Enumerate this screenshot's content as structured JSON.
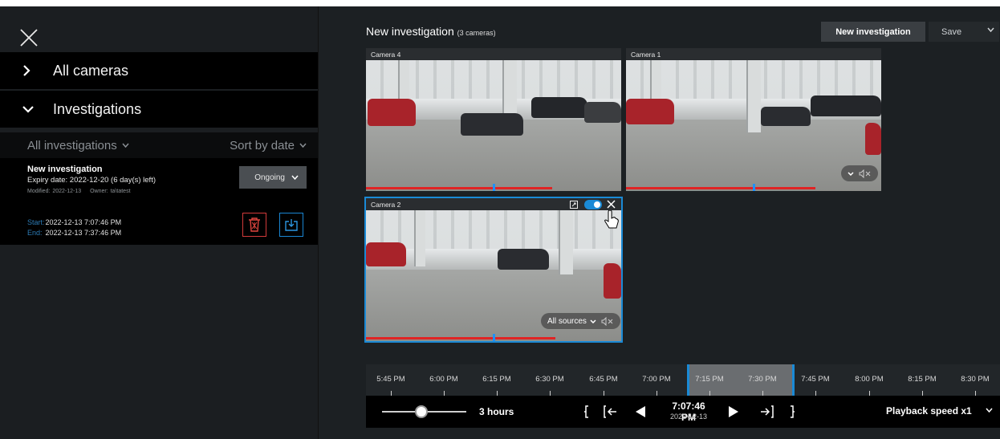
{
  "sidebar": {
    "sections": [
      {
        "label": "All cameras"
      },
      {
        "label": "Investigations"
      }
    ],
    "filter_label": "All investigations",
    "sort_label": "Sort by date",
    "investigation": {
      "title": "New investigation",
      "expiry": "Expiry date: 2022-12-20 (6 day(s) left)",
      "modified": "Modified: 2022-12-13",
      "owner": "Owner: ta\\tatest",
      "status": "Ongoing",
      "start_key": "Start:",
      "start_value": "2022-12-13 7:07:46 PM",
      "end_key": "End:",
      "end_value": "2022-12-13 7:37:46 PM"
    }
  },
  "header": {
    "title": "New investigation",
    "camera_count": "(3 cameras)",
    "new_button": "New investigation",
    "save_button": "Save"
  },
  "cameras": [
    {
      "name": "Camera 4"
    },
    {
      "name": "Camera 1"
    },
    {
      "name": "Camera 2",
      "sources_label": "All sources"
    }
  ],
  "timeline": {
    "labels": [
      "5:45 PM",
      "6:00 PM",
      "6:15 PM",
      "6:30 PM",
      "6:45 PM",
      "7:00 PM",
      "7:15 PM",
      "7:30 PM",
      "7:45 PM",
      "8:00 PM",
      "8:15 PM",
      "8:30 PM"
    ]
  },
  "playback": {
    "range": "3 hours",
    "time": "7:07:46 PM",
    "date": "2022-12-13",
    "speed": "Playback speed x1"
  },
  "colors": {
    "accent": "#1a8ad6",
    "delete": "#d23a3a",
    "footage_bar": "#e02424"
  }
}
